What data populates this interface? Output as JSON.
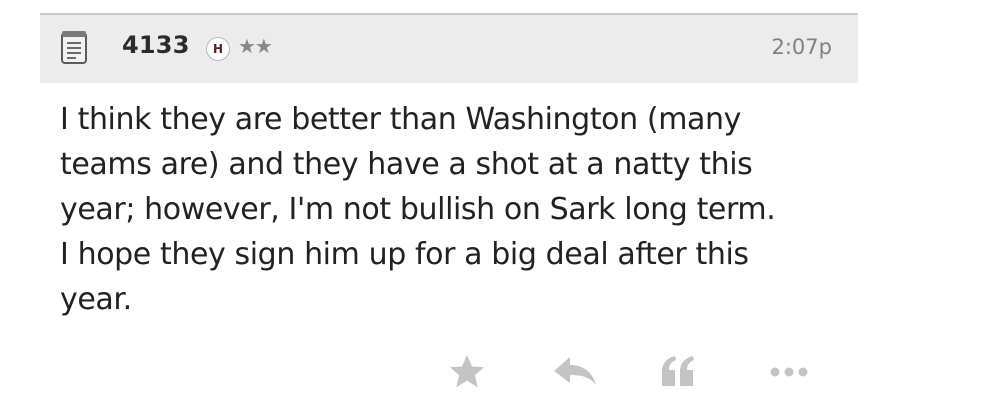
{
  "post": {
    "username": "4133",
    "badge": "H",
    "rank_stars": "★★",
    "time": "2:07p",
    "body": "I think they are better than Washington (many\nteams are) and they have a shot at a natty this\nyear; however, I'm not bullish on Sark long term.\nI hope they sign him up for a big deal after this\nyear."
  },
  "actions": [
    "star-icon",
    "reply-icon",
    "quote-icon",
    "more-icon"
  ],
  "colors": {
    "header_bg": "#ececec",
    "header_border": "#c9c9c9",
    "icon_gray": "#c4c4c4",
    "timestamp": "#808080",
    "badge_text": "#5a1e1e"
  }
}
